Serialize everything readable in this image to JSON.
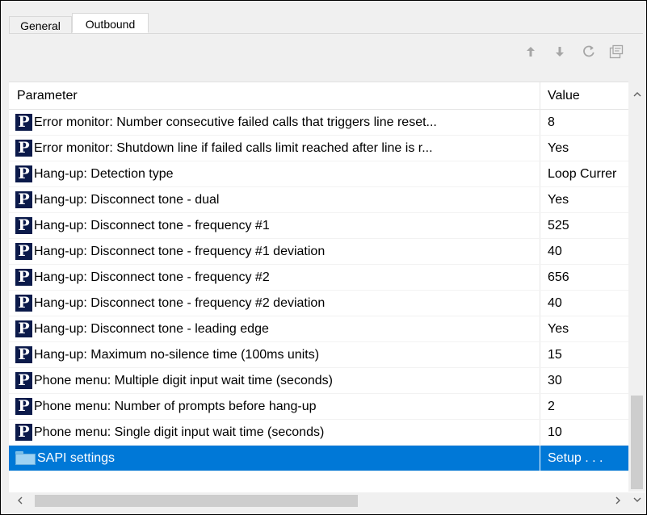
{
  "tabs": [
    {
      "label": "General",
      "active": false
    },
    {
      "label": "Outbound",
      "active": true
    }
  ],
  "toolbar": {
    "icons": [
      "arrow-up-icon",
      "arrow-down-icon",
      "refresh-icon",
      "properties-icon"
    ]
  },
  "grid": {
    "columns": {
      "parameter": "Parameter",
      "value": "Value"
    },
    "rows": [
      {
        "icon": "parameter-p-icon",
        "parameter": "Error monitor: Number consecutive failed calls that triggers line reset...",
        "value": "8"
      },
      {
        "icon": "parameter-p-icon",
        "parameter": "Error monitor: Shutdown line if failed calls limit reached after line is r...",
        "value": "Yes"
      },
      {
        "icon": "parameter-p-icon",
        "parameter": "Hang-up: Detection type",
        "value": "Loop Currer"
      },
      {
        "icon": "parameter-p-icon",
        "parameter": "Hang-up: Disconnect tone - dual",
        "value": "Yes"
      },
      {
        "icon": "parameter-p-icon",
        "parameter": "Hang-up: Disconnect tone - frequency #1",
        "value": "525"
      },
      {
        "icon": "parameter-p-icon",
        "parameter": "Hang-up: Disconnect tone - frequency #1 deviation",
        "value": "40"
      },
      {
        "icon": "parameter-p-icon",
        "parameter": "Hang-up: Disconnect tone - frequency #2",
        "value": "656"
      },
      {
        "icon": "parameter-p-icon",
        "parameter": "Hang-up: Disconnect tone - frequency #2 deviation",
        "value": "40"
      },
      {
        "icon": "parameter-p-icon",
        "parameter": "Hang-up: Disconnect tone - leading edge",
        "value": "Yes"
      },
      {
        "icon": "parameter-p-icon",
        "parameter": "Hang-up: Maximum no-silence time (100ms units)",
        "value": "15"
      },
      {
        "icon": "parameter-p-icon",
        "parameter": "Phone menu: Multiple digit input wait time (seconds)",
        "value": "30"
      },
      {
        "icon": "parameter-p-icon",
        "parameter": "Phone menu: Number of prompts before hang-up",
        "value": "2"
      },
      {
        "icon": "parameter-p-icon",
        "parameter": "Phone menu: Single digit input wait time (seconds)",
        "value": "10"
      },
      {
        "icon": "folder-icon",
        "parameter": "SAPI settings",
        "value": "Setup . . .",
        "selected": true
      }
    ]
  },
  "colors": {
    "selection": "#0078d7",
    "param_icon_bg": "#0b1a4a",
    "folder_icon": "#9ed2f3"
  }
}
